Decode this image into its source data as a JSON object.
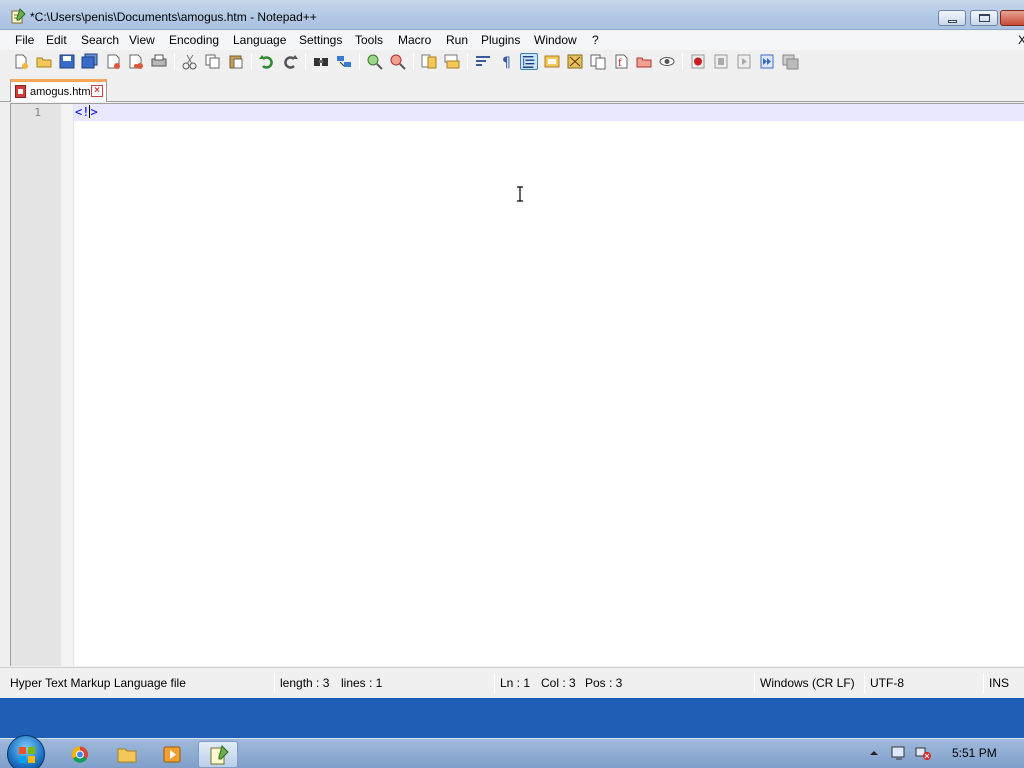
{
  "window": {
    "title": "*C:\\Users\\penis\\Documents\\amogus.htm - Notepad++"
  },
  "menu": {
    "items": [
      "File",
      "Edit",
      "Search",
      "View",
      "Encoding",
      "Language",
      "Settings",
      "Tools",
      "Macro",
      "Run",
      "Plugins",
      "Window",
      "?"
    ],
    "close_glyph": "X"
  },
  "tab": {
    "label": "amogus.htm",
    "close_glyph": "×"
  },
  "editor": {
    "line_number": "1",
    "code_before_caret": "<!",
    "code_after_caret": ">"
  },
  "status": {
    "file_type": "Hyper Text Markup Language file",
    "length": "length : 3",
    "lines": "lines : 1",
    "ln": "Ln : 1",
    "col": "Col : 3",
    "pos": "Pos : 3",
    "eol": "Windows (CR LF)",
    "encoding": "UTF-8",
    "mode": "INS"
  },
  "taskbar": {
    "clock": "5:51 PM"
  },
  "colors": {
    "current_line": "#e8e8ff",
    "tab_accent": "#f8a75c",
    "code_tag": "#0000ff",
    "desktop": "#1f5fb5"
  }
}
